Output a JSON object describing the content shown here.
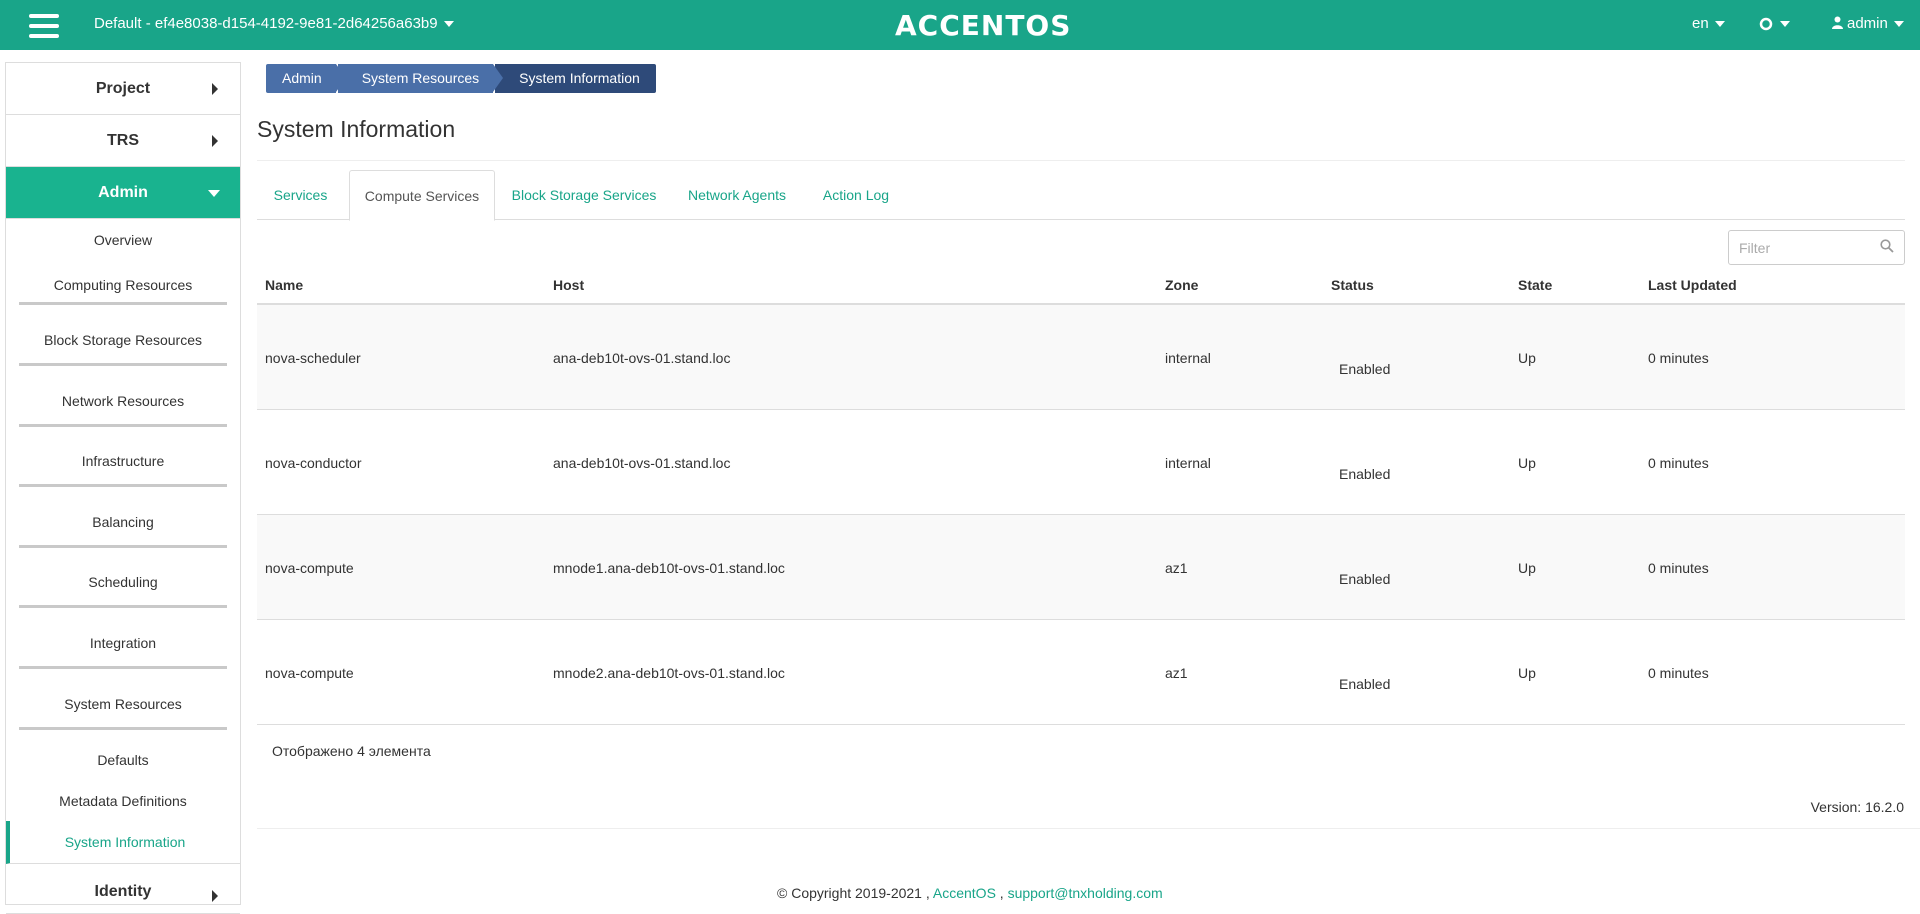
{
  "topbar": {
    "project": "Default - ef4e8038-d154-4192-9e81-2d64256a63b9",
    "logo": "ACCENTOS",
    "lang": "en",
    "user": "admin"
  },
  "sidebar": {
    "project": "Project",
    "trs": "TRS",
    "admin": "Admin",
    "items": [
      "Overview",
      "Computing Resources",
      "Block Storage Resources",
      "Network Resources",
      "Infrastructure",
      "Balancing",
      "Scheduling",
      "Integration",
      "System Resources"
    ],
    "subitems": [
      "Defaults",
      "Metadata Definitions",
      "System Information"
    ],
    "identity": "Identity"
  },
  "breadcrumb": [
    "Admin",
    "System Resources",
    "System Information"
  ],
  "page_title": "System Information",
  "tabs": [
    "Services",
    "Compute Services",
    "Block Storage Services",
    "Network Agents",
    "Action Log"
  ],
  "filter_placeholder": "Filter",
  "table": {
    "headers": [
      "Name",
      "Host",
      "Zone",
      "Status",
      "State",
      "Last Updated"
    ],
    "rows": [
      {
        "name": "nova-scheduler",
        "host": "ana-deb10t-ovs-01.stand.loc",
        "zone": "internal",
        "status": "Enabled",
        "state": "Up",
        "updated": "0 minutes"
      },
      {
        "name": "nova-conductor",
        "host": "ana-deb10t-ovs-01.stand.loc",
        "zone": "internal",
        "status": "Enabled",
        "state": "Up",
        "updated": "0 minutes"
      },
      {
        "name": "nova-compute",
        "host": "mnode1.ana-deb10t-ovs-01.stand.loc",
        "zone": "az1",
        "status": "Enabled",
        "state": "Up",
        "updated": "0 minutes"
      },
      {
        "name": "nova-compute",
        "host": "mnode2.ana-deb10t-ovs-01.stand.loc",
        "zone": "az1",
        "status": "Enabled",
        "state": "Up",
        "updated": "0 minutes"
      }
    ]
  },
  "count_text": "Отображено 4 элемента",
  "version": "Version: 16.2.0",
  "footer": {
    "copyright": "© Copyright 2019-2021 ,",
    "brand": "AccentOS",
    "sep": ",",
    "email": "support@tnxholding.com"
  },
  "colors": {
    "accent": "#19a589",
    "breadcrumb": "#4a6fa8",
    "breadcrumb_current": "#2e4a79"
  }
}
